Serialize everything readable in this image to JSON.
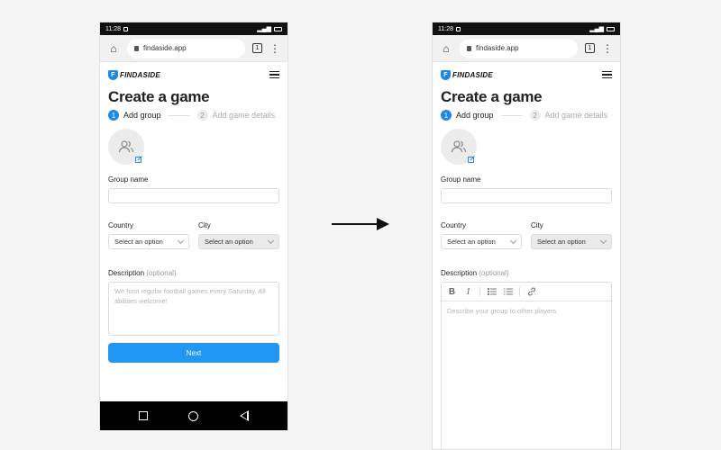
{
  "status": {
    "time": "11:28"
  },
  "browser": {
    "url": "findaside.app",
    "tab_count": "1"
  },
  "brand": {
    "name": "FINDASIDE",
    "mark": "F",
    "accent": "#1e88e5"
  },
  "page": {
    "title": "Create a game"
  },
  "steps": [
    {
      "num": "1",
      "label": "Add group"
    },
    {
      "num": "2",
      "label": "Add game details"
    }
  ],
  "form": {
    "group_name_label": "Group name",
    "country_label": "Country",
    "city_label": "City",
    "select_placeholder": "Select an option",
    "description_label": "Description",
    "optional": "(optional)",
    "left_description_placeholder": "We host regular football games every Saturday. All abilities welcome!",
    "right_description_placeholder": "Describe your group to other players",
    "next_label": "Next"
  },
  "toolbar": {
    "bold": "B",
    "italic": "I"
  }
}
